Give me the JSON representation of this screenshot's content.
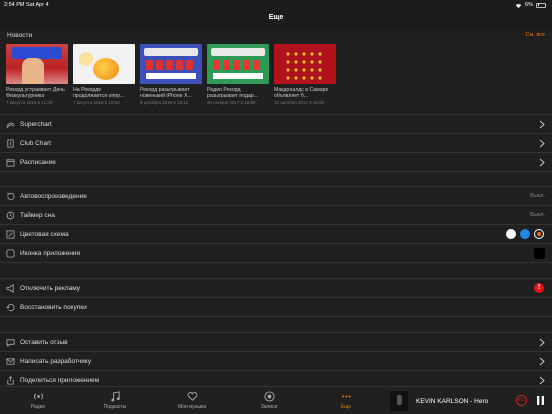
{
  "status": {
    "time": "2:54 PM",
    "date": "Sat Apr 4",
    "battery": "6%"
  },
  "nav": {
    "title": "Еще"
  },
  "news": {
    "title": "Новости",
    "see_all": "См. все",
    "items": [
      {
        "title": "Рекорд устраивает День Физкультурника",
        "date": "7 августа 2018 в 11:00"
      },
      {
        "title": "На Рекорде продолжается опер...",
        "date": "7 августа 2018 в 10:50"
      },
      {
        "title": "Рекорд разыгрывает новенький iPhone X...",
        "date": "5 декабря 2018 в 16:12"
      },
      {
        "title": "Радио Рекорд разыгрывает подар...",
        "date": "30 ноября 2017 в 18:50"
      },
      {
        "title": "Макдоналдс в Самаре объявляет б...",
        "date": "20 октября 2017 в 16:50"
      }
    ]
  },
  "charts": [
    {
      "label": "Superchart",
      "icon": "superchart-icon"
    },
    {
      "label": "Club Chart",
      "icon": "club-chart-icon"
    },
    {
      "label": "Расписание",
      "icon": "calendar-icon"
    }
  ],
  "settings": {
    "autoplay": {
      "label": "Автовоспроизведение",
      "value": "Выкл."
    },
    "sleep_timer": {
      "label": "Таймер сна",
      "value": "Выкл."
    },
    "color_scheme": {
      "label": "Цветовая схема",
      "colors": [
        "#ffffff",
        "#1e88e5",
        "#ef6c00"
      ],
      "selected": "#ef6c00"
    },
    "app_icon": {
      "label": "Иконка приложения"
    }
  },
  "purchases": {
    "disable_ads": {
      "label": "Отключить рекламу",
      "badge": "!"
    },
    "restore": {
      "label": "Восстановить покупки"
    }
  },
  "feedback": [
    {
      "label": "Оставить отзыв",
      "icon": "review-icon"
    },
    {
      "label": "Написать разработчику",
      "icon": "mail-icon"
    },
    {
      "label": "Поделиться приложением",
      "icon": "share-icon"
    }
  ],
  "tabs": [
    {
      "label": "Радио",
      "icon": "radio-icon"
    },
    {
      "label": "Подкасты",
      "icon": "music-note-icon"
    },
    {
      "label": "Моя музыка",
      "icon": "heart-icon"
    },
    {
      "label": "Записи",
      "icon": "rec-icon"
    },
    {
      "label": "Еще",
      "icon": "more-icon",
      "active": true
    }
  ],
  "player": {
    "track": "KEVIN KARLSON - Hero",
    "rec_label": "REC"
  },
  "colors": {
    "accent": "#e07a1a",
    "background": "#1f1f1f",
    "badge": "#e0161b"
  }
}
